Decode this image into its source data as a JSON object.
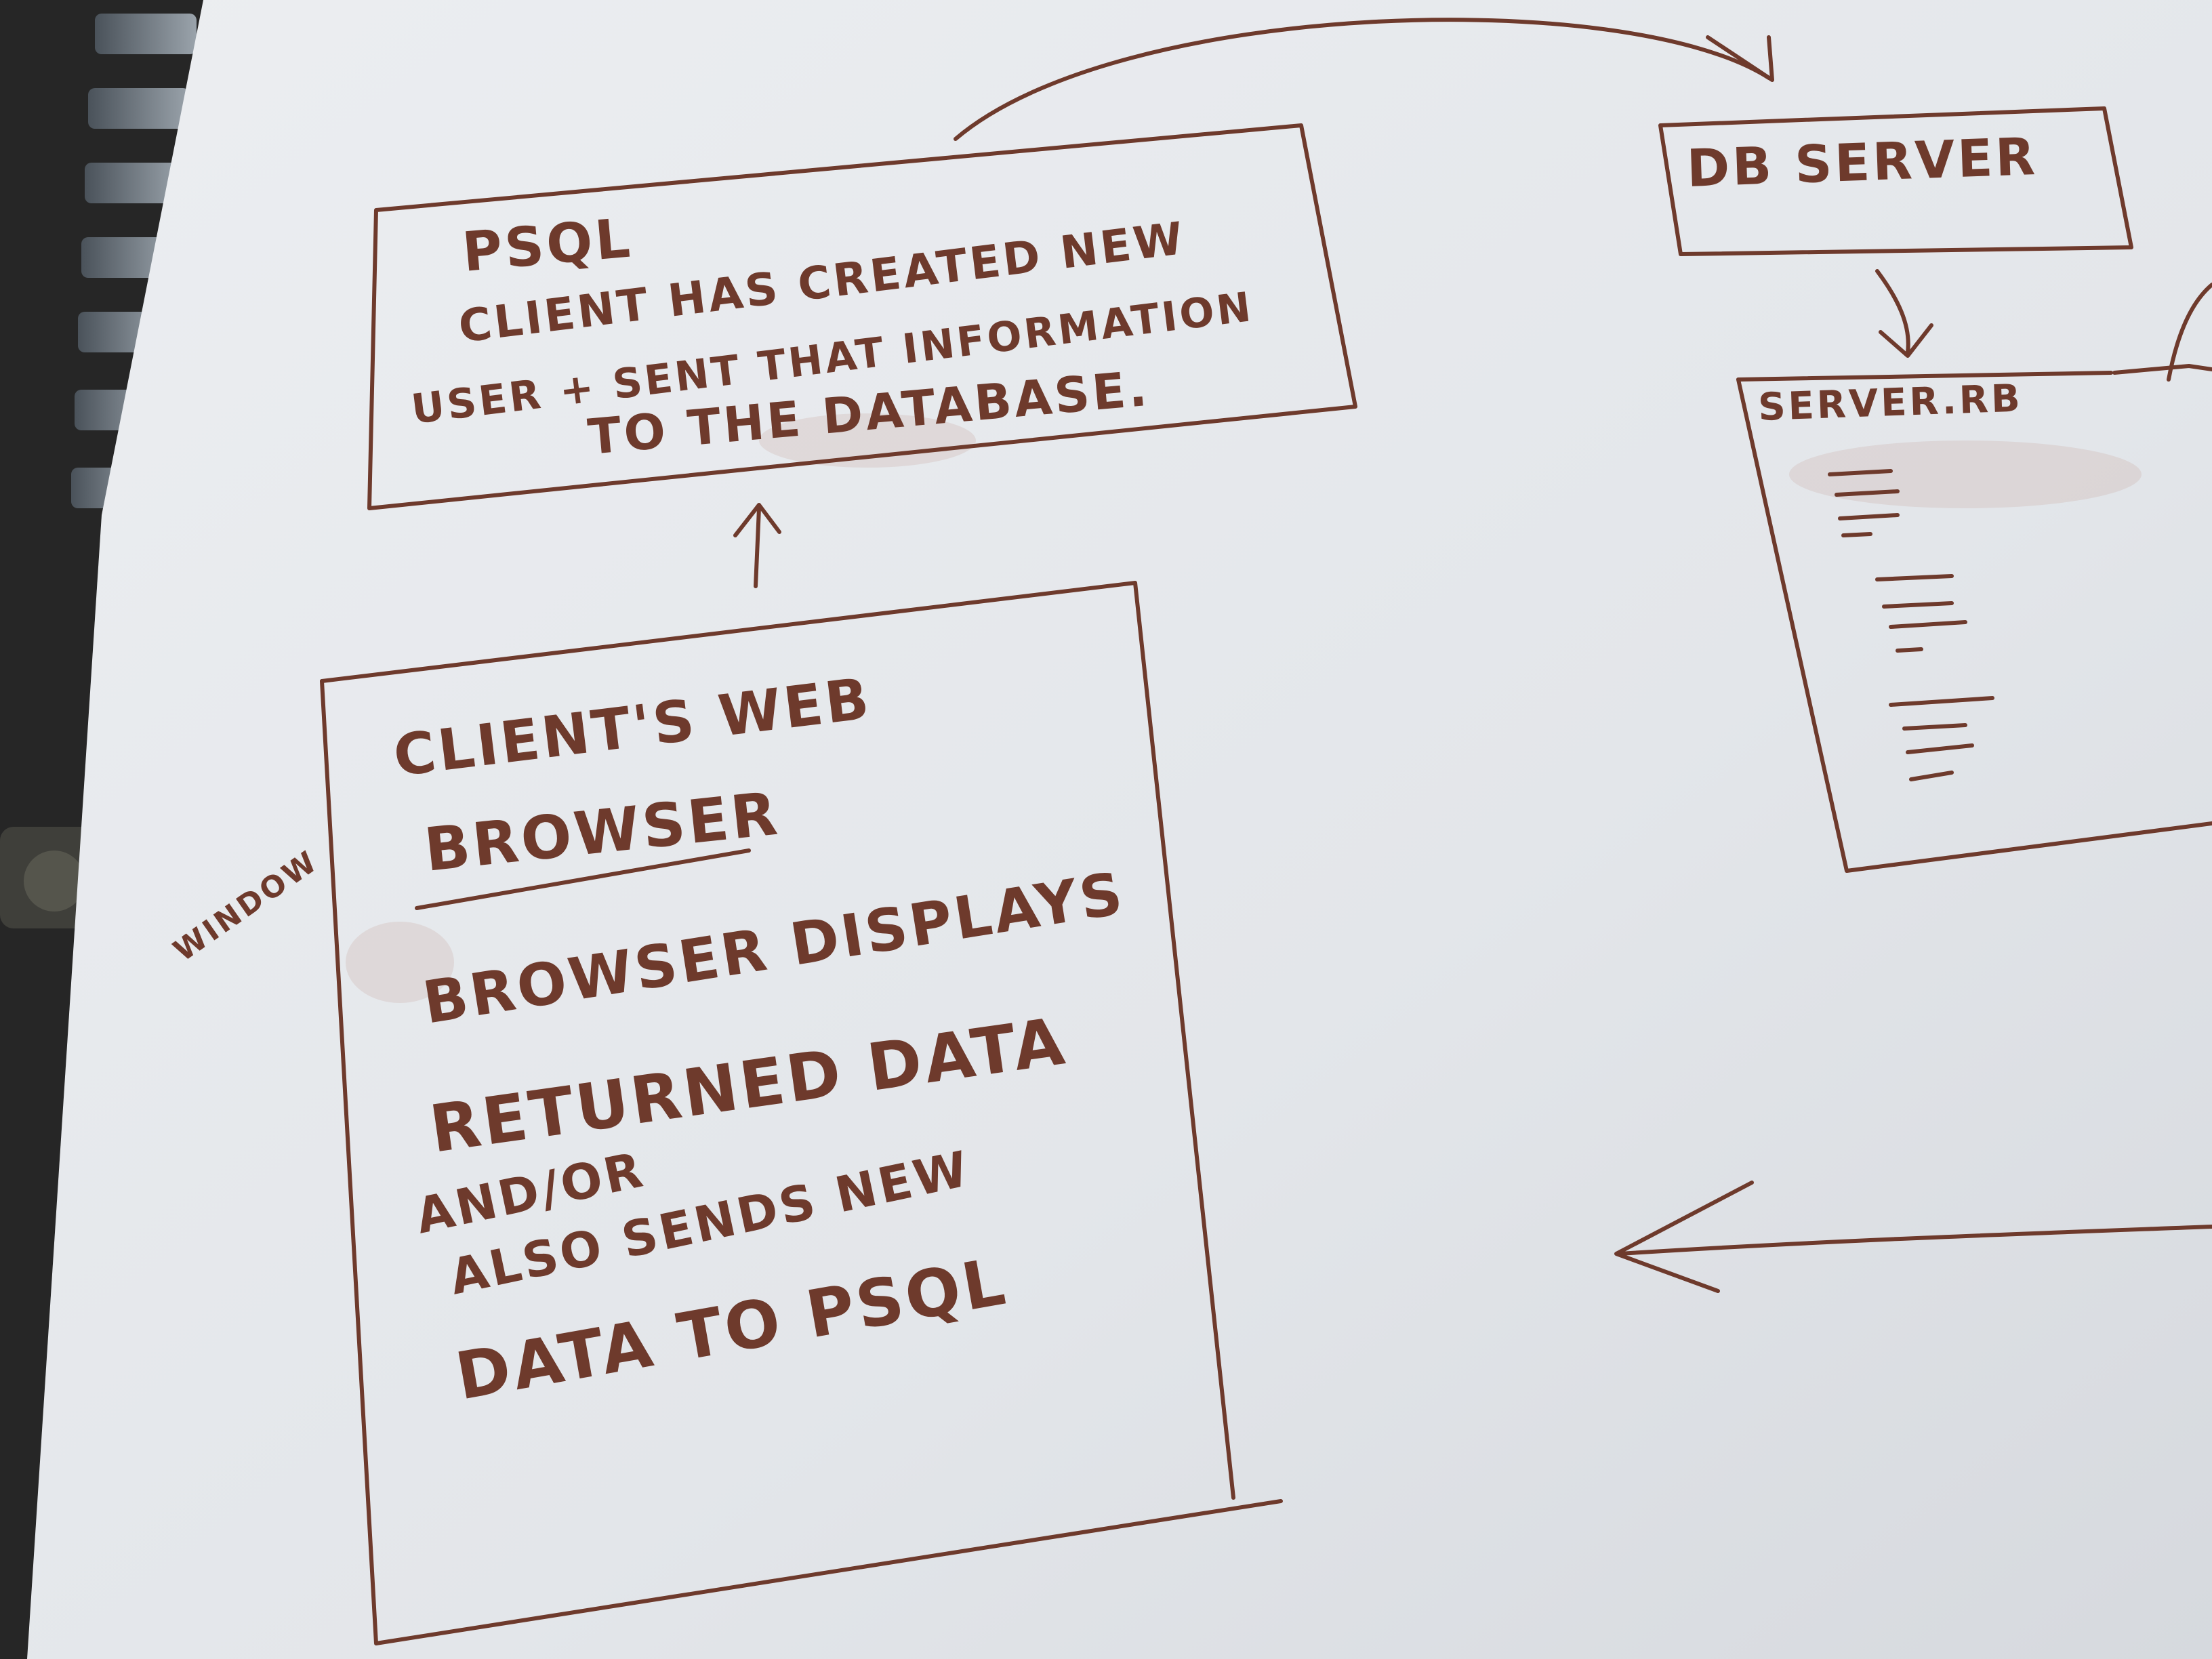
{
  "colors": {
    "background": "#2a2a2a",
    "whiteboard": "#e6e8ec",
    "marker": "#6e3a2c",
    "radiator": "#7d8790"
  },
  "psql_box": {
    "title": "PSQL",
    "lines": [
      "CLIENT HAS CREATED NEW",
      "USER + SENT THAT INFORMATION",
      "TO THE DATABASE."
    ]
  },
  "db_server_box": {
    "title": "DB SERVER"
  },
  "server_rb_box": {
    "title": "SERVER.RB"
  },
  "client_box": {
    "title_line1": "CLIENT'S WEB",
    "title_line2": "BROWSER",
    "lines": [
      "BROWSER DISPLAYS",
      "RETURNED DATA",
      "AND/OR",
      "ALSO SENDS NEW",
      "DATA TO PSQL"
    ]
  },
  "side_note": "WINDOW"
}
